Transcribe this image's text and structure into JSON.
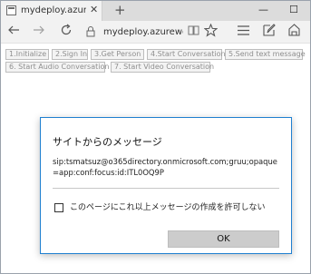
{
  "tab": {
    "title": "mydeploy.azurewebsites",
    "close_glyph": "✕",
    "new_tab_glyph": "+"
  },
  "window_controls": {
    "minimize": "—",
    "maximize": "☐"
  },
  "toolbar": {
    "url": "mydeploy.azurewel",
    "back_icon": "arrow-left-icon",
    "forward_icon": "arrow-right-icon",
    "refresh_icon": "refresh-icon",
    "lock_icon": "lock-icon",
    "reading_icon": "reading-view-icon",
    "favorite_icon": "star-icon",
    "hub_icon": "hub-icon",
    "note_icon": "web-note-icon",
    "share_icon": "share-icon"
  },
  "page": {
    "buttons": [
      "1.Initialize",
      "2.Sign In",
      "3.Get Person",
      "4.Start Conversation",
      "5.Send text message",
      "6. Start Audio Conversation",
      "7. Start Video Conversation"
    ]
  },
  "dialog": {
    "title": "サイトからのメッセージ",
    "message": "sip:tsmatsuz@o365directory.onmicrosoft.com;gruu;opaque=app:conf:focus:id:ITL0OQ9P",
    "checkbox_label": "このページにこれ以上メッセージの作成を許可しない",
    "checkbox_checked": false,
    "ok_label": "OK"
  },
  "colors": {
    "dialog_border": "#1f7fd0",
    "ok_button_bg": "#cccccc",
    "page_button_text": "#8f8f8f"
  }
}
